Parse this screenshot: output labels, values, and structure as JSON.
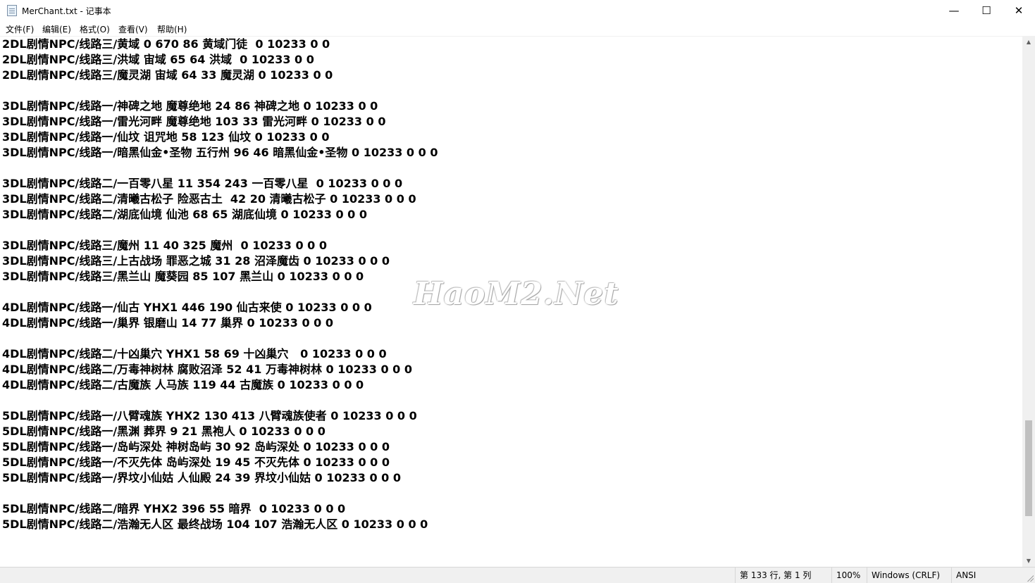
{
  "window": {
    "title": "MerChant.txt - 记事本",
    "minimize_glyph": "—",
    "maximize_glyph": "☐",
    "close_glyph": "✕"
  },
  "menu": {
    "items": [
      "文件(F)",
      "编辑(E)",
      "格式(O)",
      "查看(V)",
      "帮助(H)"
    ]
  },
  "editor": {
    "lines": [
      "2DL剧情NPC/线路三/黄域 0 670 86 黄域门徒  0 10233 0 0",
      "2DL剧情NPC/线路三/洪域 宙域 65 64 洪域  0 10233 0 0",
      "2DL剧情NPC/线路三/魔灵湖 宙域 64 33 魔灵湖 0 10233 0 0",
      "",
      "3DL剧情NPC/线路一/神碑之地 魔尊绝地 24 86 神碑之地 0 10233 0 0",
      "3DL剧情NPC/线路一/雷光河畔 魔尊绝地 103 33 雷光河畔 0 10233 0 0",
      "3DL剧情NPC/线路一/仙坟 诅咒地 58 123 仙坟 0 10233 0 0",
      "3DL剧情NPC/线路一/暗黑仙金•圣物 五行州 96 46 暗黑仙金•圣物 0 10233 0 0 0",
      "",
      "3DL剧情NPC/线路二/一百零八星 11 354 243 一百零八星  0 10233 0 0 0",
      "3DL剧情NPC/线路二/清曦古松子 险恶古土  42 20 清曦古松子 0 10233 0 0 0",
      "3DL剧情NPC/线路二/湖底仙境 仙池 68 65 湖底仙境 0 10233 0 0 0",
      "",
      "3DL剧情NPC/线路三/魔州 11 40 325 魔州  0 10233 0 0 0",
      "3DL剧情NPC/线路三/上古战场 罪恶之城 31 28 沼泽魔齿 0 10233 0 0 0",
      "3DL剧情NPC/线路三/黑兰山 魔葵园 85 107 黑兰山 0 10233 0 0 0",
      "",
      "4DL剧情NPC/线路一/仙古 YHX1 446 190 仙古来使 0 10233 0 0 0",
      "4DL剧情NPC/线路一/巢界 银磨山 14 77 巢界 0 10233 0 0 0",
      "",
      "4DL剧情NPC/线路二/十凶巢穴 YHX1 58 69 十凶巢穴   0 10233 0 0 0",
      "4DL剧情NPC/线路二/万毒神树林 腐败沼泽 52 41 万毒神树林 0 10233 0 0 0",
      "4DL剧情NPC/线路二/古魔族 人马族 119 44 古魔族 0 10233 0 0 0",
      "",
      "5DL剧情NPC/线路一/八臂魂族 YHX2 130 413 八臂魂族使者 0 10233 0 0 0",
      "5DL剧情NPC/线路一/黑渊 葬界 9 21 黑袍人 0 10233 0 0 0",
      "5DL剧情NPC/线路一/岛屿深处 神树岛屿 30 92 岛屿深处 0 10233 0 0 0",
      "5DL剧情NPC/线路一/不灭先体 岛屿深处 19 45 不灭先体 0 10233 0 0 0",
      "5DL剧情NPC/线路一/界坟小仙姑 人仙殿 24 39 界坟小仙姑 0 10233 0 0 0",
      "",
      "5DL剧情NPC/线路二/暗界 YHX2 396 55 暗界  0 10233 0 0 0",
      "5DL剧情NPC/线路二/浩瀚无人区 最终战场 104 107 浩瀚无人区 0 10233 0 0 0"
    ],
    "watermark": "HaoM2.Net"
  },
  "status": {
    "position": "第 133 行, 第 1 列",
    "zoom": "100%",
    "line_ending": "Windows (CRLF)",
    "encoding": "ANSI"
  },
  "icons": {
    "app": "notepad-icon",
    "scroll_up": "▲",
    "scroll_down": "▼"
  }
}
